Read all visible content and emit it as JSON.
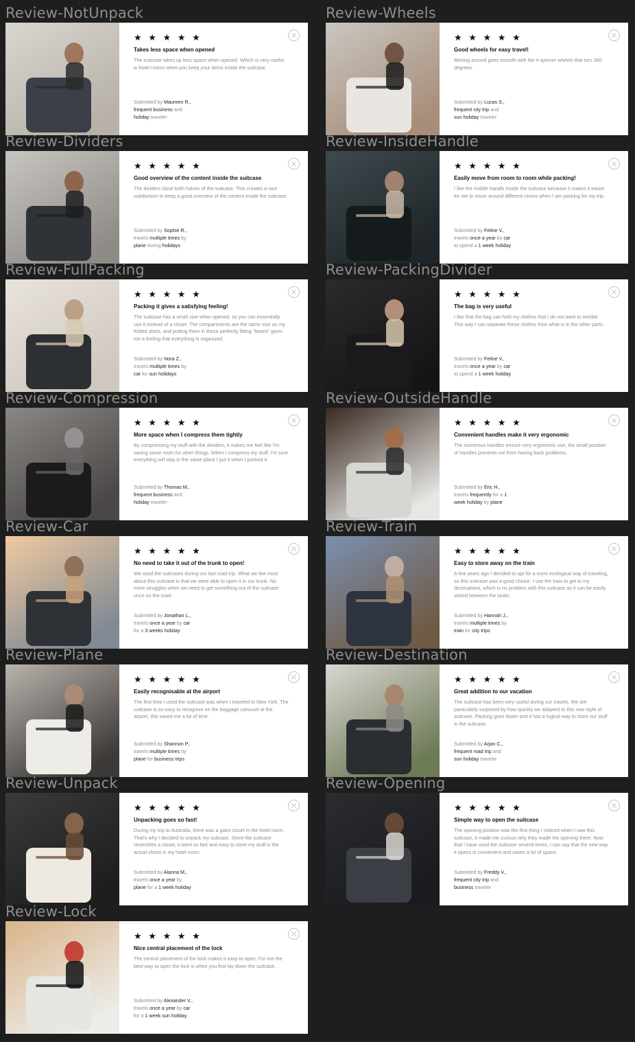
{
  "stars": "★ ★ ★ ★ ★",
  "common": {
    "submitted_by": "Submitted by "
  },
  "reviews": [
    {
      "frame": "Review-NotUnpack",
      "title": "Takes less space when opened",
      "body": "The suitcase takes up less space when opened. Which is very useful in hotel rooms when you keep your items inside the suitcase.",
      "name": "Maureen R.,",
      "sub": [
        {
          "t": "frequent business",
          "h": true
        },
        {
          "t": " and",
          "h": false
        }
      ],
      "sub2": [
        {
          "t": "holiday",
          "h": true
        },
        {
          "t": " traveler",
          "h": false
        }
      ],
      "photo": {
        "bg1": "#d9d6d0",
        "bg2": "#b7b1a8",
        "obj": "#3b4048",
        "acc": "#2a2a2a",
        "skin": "#9a6e52"
      }
    },
    {
      "frame": "Review-Wheels",
      "title": "Good wheels for easy travel!",
      "body": "Moving around goes smooth with the 4 spinner wheels that turn 360 degrees.",
      "name": "Lucas S.,",
      "sub": [
        {
          "t": "frequent city trip",
          "h": true
        },
        {
          "t": " and",
          "h": false
        }
      ],
      "sub2": [
        {
          "t": "sun holiday",
          "h": true
        },
        {
          "t": " traveler",
          "h": false
        }
      ],
      "photo": {
        "bg1": "#c9c6c0",
        "bg2": "#a88e7a",
        "obj": "#e9e6e1",
        "acc": "#1b1b1b",
        "skin": "#6b4a3a"
      }
    },
    {
      "frame": "Review-Dividers",
      "title": "Good overview of the content inside the suitcase",
      "body": "The dividers close both halves of the suitcase. This creates a nice subdivision to keep a good overview of the content inside the suitcase.",
      "name": "Sophie R.,",
      "sub": [
        {
          "t": "travels ",
          "h": false
        },
        {
          "t": "multiple times",
          "h": true
        },
        {
          "t": " by",
          "h": false
        }
      ],
      "sub2": [
        {
          "t": "plane",
          "h": true
        },
        {
          "t": " during ",
          "h": false
        },
        {
          "t": "holidays",
          "h": true
        }
      ],
      "photo": {
        "bg1": "#c8c5c0",
        "bg2": "#8f8c88",
        "obj": "#2f3338",
        "acc": "#1d1f22",
        "skin": "#8a5e45"
      }
    },
    {
      "frame": "Review-InsideHandle",
      "title": "Easily move from room to room while packing!",
      "body": "I like the middle handle inside the suitcase because it makes it easier for me to move around different rooms when I am packing for my trip.",
      "name": "Feline V.,",
      "sub": [
        {
          "t": "travels ",
          "h": false
        },
        {
          "t": "once a year",
          "h": true
        },
        {
          "t": " by ",
          "h": false
        },
        {
          "t": "car",
          "h": true
        }
      ],
      "sub2": [
        {
          "t": "to spend a ",
          "h": false
        },
        {
          "t": "1 week holiday",
          "h": true
        }
      ],
      "photo": {
        "bg1": "#3e4a4e",
        "bg2": "#1f2528",
        "obj": "#151a1c",
        "acc": "#c9b9a8",
        "skin": "#b08a76"
      }
    },
    {
      "frame": "Review-FullPacking",
      "title": "Packing it gives a satisfying feeling!",
      "body": "The suitcase has a small size when opened, so you can essentially use it instead of a closet. The compartments are the same size as my folded shirts, and putting them in these perfectly fitting \"boxes\" gives me a feeling that everything is organized.",
      "name": "Nora Z.,",
      "sub": [
        {
          "t": "travels ",
          "h": false
        },
        {
          "t": "multiple times",
          "h": true
        },
        {
          "t": " by",
          "h": false
        }
      ],
      "sub2": [
        {
          "t": "car",
          "h": true
        },
        {
          "t": " for ",
          "h": false
        },
        {
          "t": "sun holidays",
          "h": true
        }
      ],
      "photo": {
        "bg1": "#e8e3dc",
        "bg2": "#cfc8bf",
        "obj": "#2c2f33",
        "acc": "#d8c9b4",
        "skin": "#b89b80"
      }
    },
    {
      "frame": "Review-PackingDivider",
      "title": "The bag is very useful",
      "body": "I like that the bag can hold my clothes that I do not want to wrinkle. This way I can separate these clothes from what is in the other parts.",
      "name": "Feline V.,",
      "sub": [
        {
          "t": "travels ",
          "h": false
        },
        {
          "t": "once a year",
          "h": true
        },
        {
          "t": " by ",
          "h": false
        },
        {
          "t": "car",
          "h": true
        }
      ],
      "sub2": [
        {
          "t": "to spend a ",
          "h": false
        },
        {
          "t": "1 week holiday",
          "h": true
        }
      ],
      "photo": {
        "bg1": "#2b2a2c",
        "bg2": "#151416",
        "obj": "#1a1a1c",
        "acc": "#d7c6ad",
        "skin": "#c39a82"
      }
    },
    {
      "frame": "Review-Compression",
      "title": "More space when I compress them tightly",
      "body": "By compressing my stuff with the dividers, it makes me feel like I'm saving some room for other things. When I compress my stuff, I'm sure everything will stay in the same place I put it when I packed it.",
      "name": "Thomas M.,",
      "sub": [
        {
          "t": "frequent business",
          "h": true
        },
        {
          "t": " and",
          "h": false
        }
      ],
      "sub2": [
        {
          "t": "holiday",
          "h": true
        },
        {
          "t": " traveler",
          "h": false
        }
      ],
      "photo": {
        "bg1": "#8a8784",
        "bg2": "#4a4746",
        "obj": "#1b1b1e",
        "acc": "#6a6666",
        "skin": "#9a9696"
      }
    },
    {
      "frame": "Review-OutsideHandle",
      "title": "Convenient handles make it very ergonomic",
      "body": "The numerous handles ensure very ergonomic use, the small position of handles prevents me from having back problems.",
      "name": "Eric H.,",
      "sub": [
        {
          "t": "travels ",
          "h": false
        },
        {
          "t": "frequently",
          "h": true
        },
        {
          "t": " for a ",
          "h": false
        },
        {
          "t": "1",
          "h": true
        }
      ],
      "sub2": [
        {
          "t": "week holiday",
          "h": true
        },
        {
          "t": " by ",
          "h": false
        },
        {
          "t": "plane",
          "h": true
        }
      ],
      "photo": {
        "bg1": "#3b2a22",
        "bg2": "#e7e7e4",
        "obj": "#d6d6d2",
        "acc": "#2a2a2c",
        "skin": "#a46a46"
      }
    },
    {
      "frame": "Review-Car",
      "title": "No need to take it out of the trunk to open!",
      "body": "We used the suitcases during our last road trip. What we like most about this suitcase is that we were able to open it in our trunk. No more struggles when we need to get something out of the suitcase once on the road.",
      "name": "Jonathan L.,",
      "sub": [
        {
          "t": "travels ",
          "h": false
        },
        {
          "t": "once a year",
          "h": true
        },
        {
          "t": " by ",
          "h": false
        },
        {
          "t": "car",
          "h": true
        }
      ],
      "sub2": [
        {
          "t": "for a ",
          "h": false
        },
        {
          "t": "3 weeks holiday",
          "h": true
        }
      ],
      "photo": {
        "bg1": "#f0c9a0",
        "bg2": "#7f8a94",
        "obj": "#2e3136",
        "acc": "#c7a27a",
        "skin": "#8a6a52"
      }
    },
    {
      "frame": "Review-Train",
      "title": "Easy to store away on the train",
      "body": "A few years ago I decided to opt for a more ecological way of traveling, so this suitcase was a good choice. I use the train to get to my destinations, which is no problem with this suitcase as it can be easily stored between the seats.",
      "name": "Hannah J.,",
      "sub": [
        {
          "t": "travels ",
          "h": false
        },
        {
          "t": "multiple times",
          "h": true
        },
        {
          "t": " by",
          "h": false
        }
      ],
      "sub2": [
        {
          "t": "train",
          "h": true
        },
        {
          "t": " for ",
          "h": false
        },
        {
          "t": "city trips",
          "h": true
        }
      ],
      "photo": {
        "bg1": "#7b8fb0",
        "bg2": "#6f5a44",
        "obj": "#2d3440",
        "acc": "#b09272",
        "skin": "#c8b4a8"
      }
    },
    {
      "frame": "Review-Plane",
      "title": "Easily recognisable at the airport",
      "body": "The first time I used the suitcase was when I traveled to New York. The suitcase is so easy to recognize on the baggage carousel at the airport, this saved me a lot of time.",
      "name": "Shannon P.,",
      "sub": [
        {
          "t": "travels ",
          "h": false
        },
        {
          "t": "multiple times",
          "h": true
        },
        {
          "t": " by",
          "h": false
        }
      ],
      "sub2": [
        {
          "t": "plane",
          "h": true
        },
        {
          "t": " for ",
          "h": false
        },
        {
          "t": "business trips",
          "h": true
        }
      ],
      "photo": {
        "bg1": "#b9b3ad",
        "bg2": "#3e3a38",
        "obj": "#eeece6",
        "acc": "#1a1a1a",
        "skin": "#b08c74"
      }
    },
    {
      "frame": "Review-Destination",
      "title": "Great addition to our vacation",
      "body": "The suitcase has been very useful during our travels. We are particularly surprised by how quickly we adapted to this new style of suitcase. Packing goes faster and it has a logical way to store our stuff in the suitcase.",
      "name": "Arjan C.,",
      "sub": [
        {
          "t": "frequent road trip",
          "h": true
        },
        {
          "t": " and",
          "h": false
        }
      ],
      "sub2": [
        {
          "t": "sun holiday",
          "h": true
        },
        {
          "t": " traveler",
          "h": false
        }
      ],
      "photo": {
        "bg1": "#d9d6d2",
        "bg2": "#6c7a55",
        "obj": "#2a2d31",
        "acc": "#8e8a84",
        "skin": "#a6836a"
      }
    },
    {
      "frame": "Review-Unpack",
      "title": "Unpacking goes so fast!",
      "body": "During my trip to Australia, there was a giant closet in the hotel room. That's why I decided to unpack my suitcase. Since the suitcase resembles a closet, it went so fast and easy to store my stuff in the actual closet in my hotel room.",
      "name": "Alanna M.,",
      "sub": [
        {
          "t": "travels ",
          "h": false
        },
        {
          "t": "once a year",
          "h": true
        },
        {
          "t": " by",
          "h": false
        }
      ],
      "sub2": [
        {
          "t": "plane",
          "h": true
        },
        {
          "t": " for a ",
          "h": false
        },
        {
          "t": "1 week holiday",
          "h": true
        }
      ],
      "photo": {
        "bg1": "#3a3a3a",
        "bg2": "#1e1e1f",
        "obj": "#eeeae2",
        "acc": "#6a4b36",
        "skin": "#8e6a50"
      }
    },
    {
      "frame": "Review-Opening",
      "title": "Simple way to open the suitcase",
      "body": "The opening position was the first thing I noticed when I saw this suitcase, it made me curious why they made the opening there. Now that I have used the suitcase several times, I can say that the new way it opens is convenient and saves a lot of space.",
      "name": "Freddy V.,",
      "sub": [
        {
          "t": "frequent city trip",
          "h": true
        },
        {
          "t": " and",
          "h": false
        }
      ],
      "sub2": [
        {
          "t": "business",
          "h": true
        },
        {
          "t": " traveler",
          "h": false
        }
      ],
      "photo": {
        "bg1": "#2a2c30",
        "bg2": "#1a1b1e",
        "obj": "#3b3e44",
        "acc": "#d8d4cf",
        "skin": "#6e4c3a"
      }
    },
    {
      "frame": "Review-Lock",
      "title": "Nice central placement of the lock",
      "body": "The central placement of the lock makes it easy to open. For me the best way to open the lock is when you first lay down the suitcase.",
      "name": "Alexander V.,",
      "sub": [
        {
          "t": "travels ",
          "h": false
        },
        {
          "t": "once a year",
          "h": true
        },
        {
          "t": " by ",
          "h": false
        },
        {
          "t": "car",
          "h": true
        }
      ],
      "sub2": [
        {
          "t": "for a ",
          "h": false
        },
        {
          "t": "1 week sun holiday",
          "h": true
        }
      ],
      "photo": {
        "bg1": "#d9b48a",
        "bg2": "#ecece9",
        "obj": "#e6e6e3",
        "acc": "#111215",
        "skin": "#c0392b"
      }
    }
  ]
}
